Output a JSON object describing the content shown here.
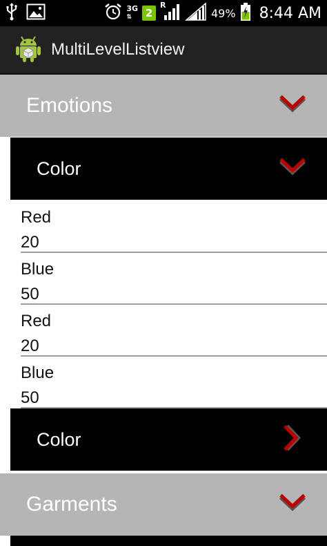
{
  "status_bar": {
    "network_type": "3G",
    "sim_badge": "2",
    "roaming": "R",
    "battery": "49%",
    "time": "8:44 AM",
    "icons": [
      "usb-icon",
      "gallery-icon",
      "alarm-icon",
      "signal-icon",
      "battery-icon"
    ]
  },
  "action_bar": {
    "title": "MultiLevelListview",
    "icon": "android-icon"
  },
  "groups": [
    {
      "label": "Emotions",
      "expanded": true
    },
    {
      "label": "Garments",
      "expanded": true
    }
  ],
  "children": [
    {
      "label": "Color",
      "expanded": true
    },
    {
      "label": "Color",
      "expanded": false
    }
  ],
  "items": [
    {
      "name": "Red",
      "value": "20"
    },
    {
      "name": "Blue",
      "value": "50"
    },
    {
      "name": "Red",
      "value": "20"
    },
    {
      "name": "Blue",
      "value": "50"
    }
  ],
  "colors": {
    "group_bg": "#b5b5b5",
    "child_bg": "#000000",
    "chevron_red": "#c00000",
    "chevron_gray": "#555555",
    "badge_green": "#7cc400"
  }
}
